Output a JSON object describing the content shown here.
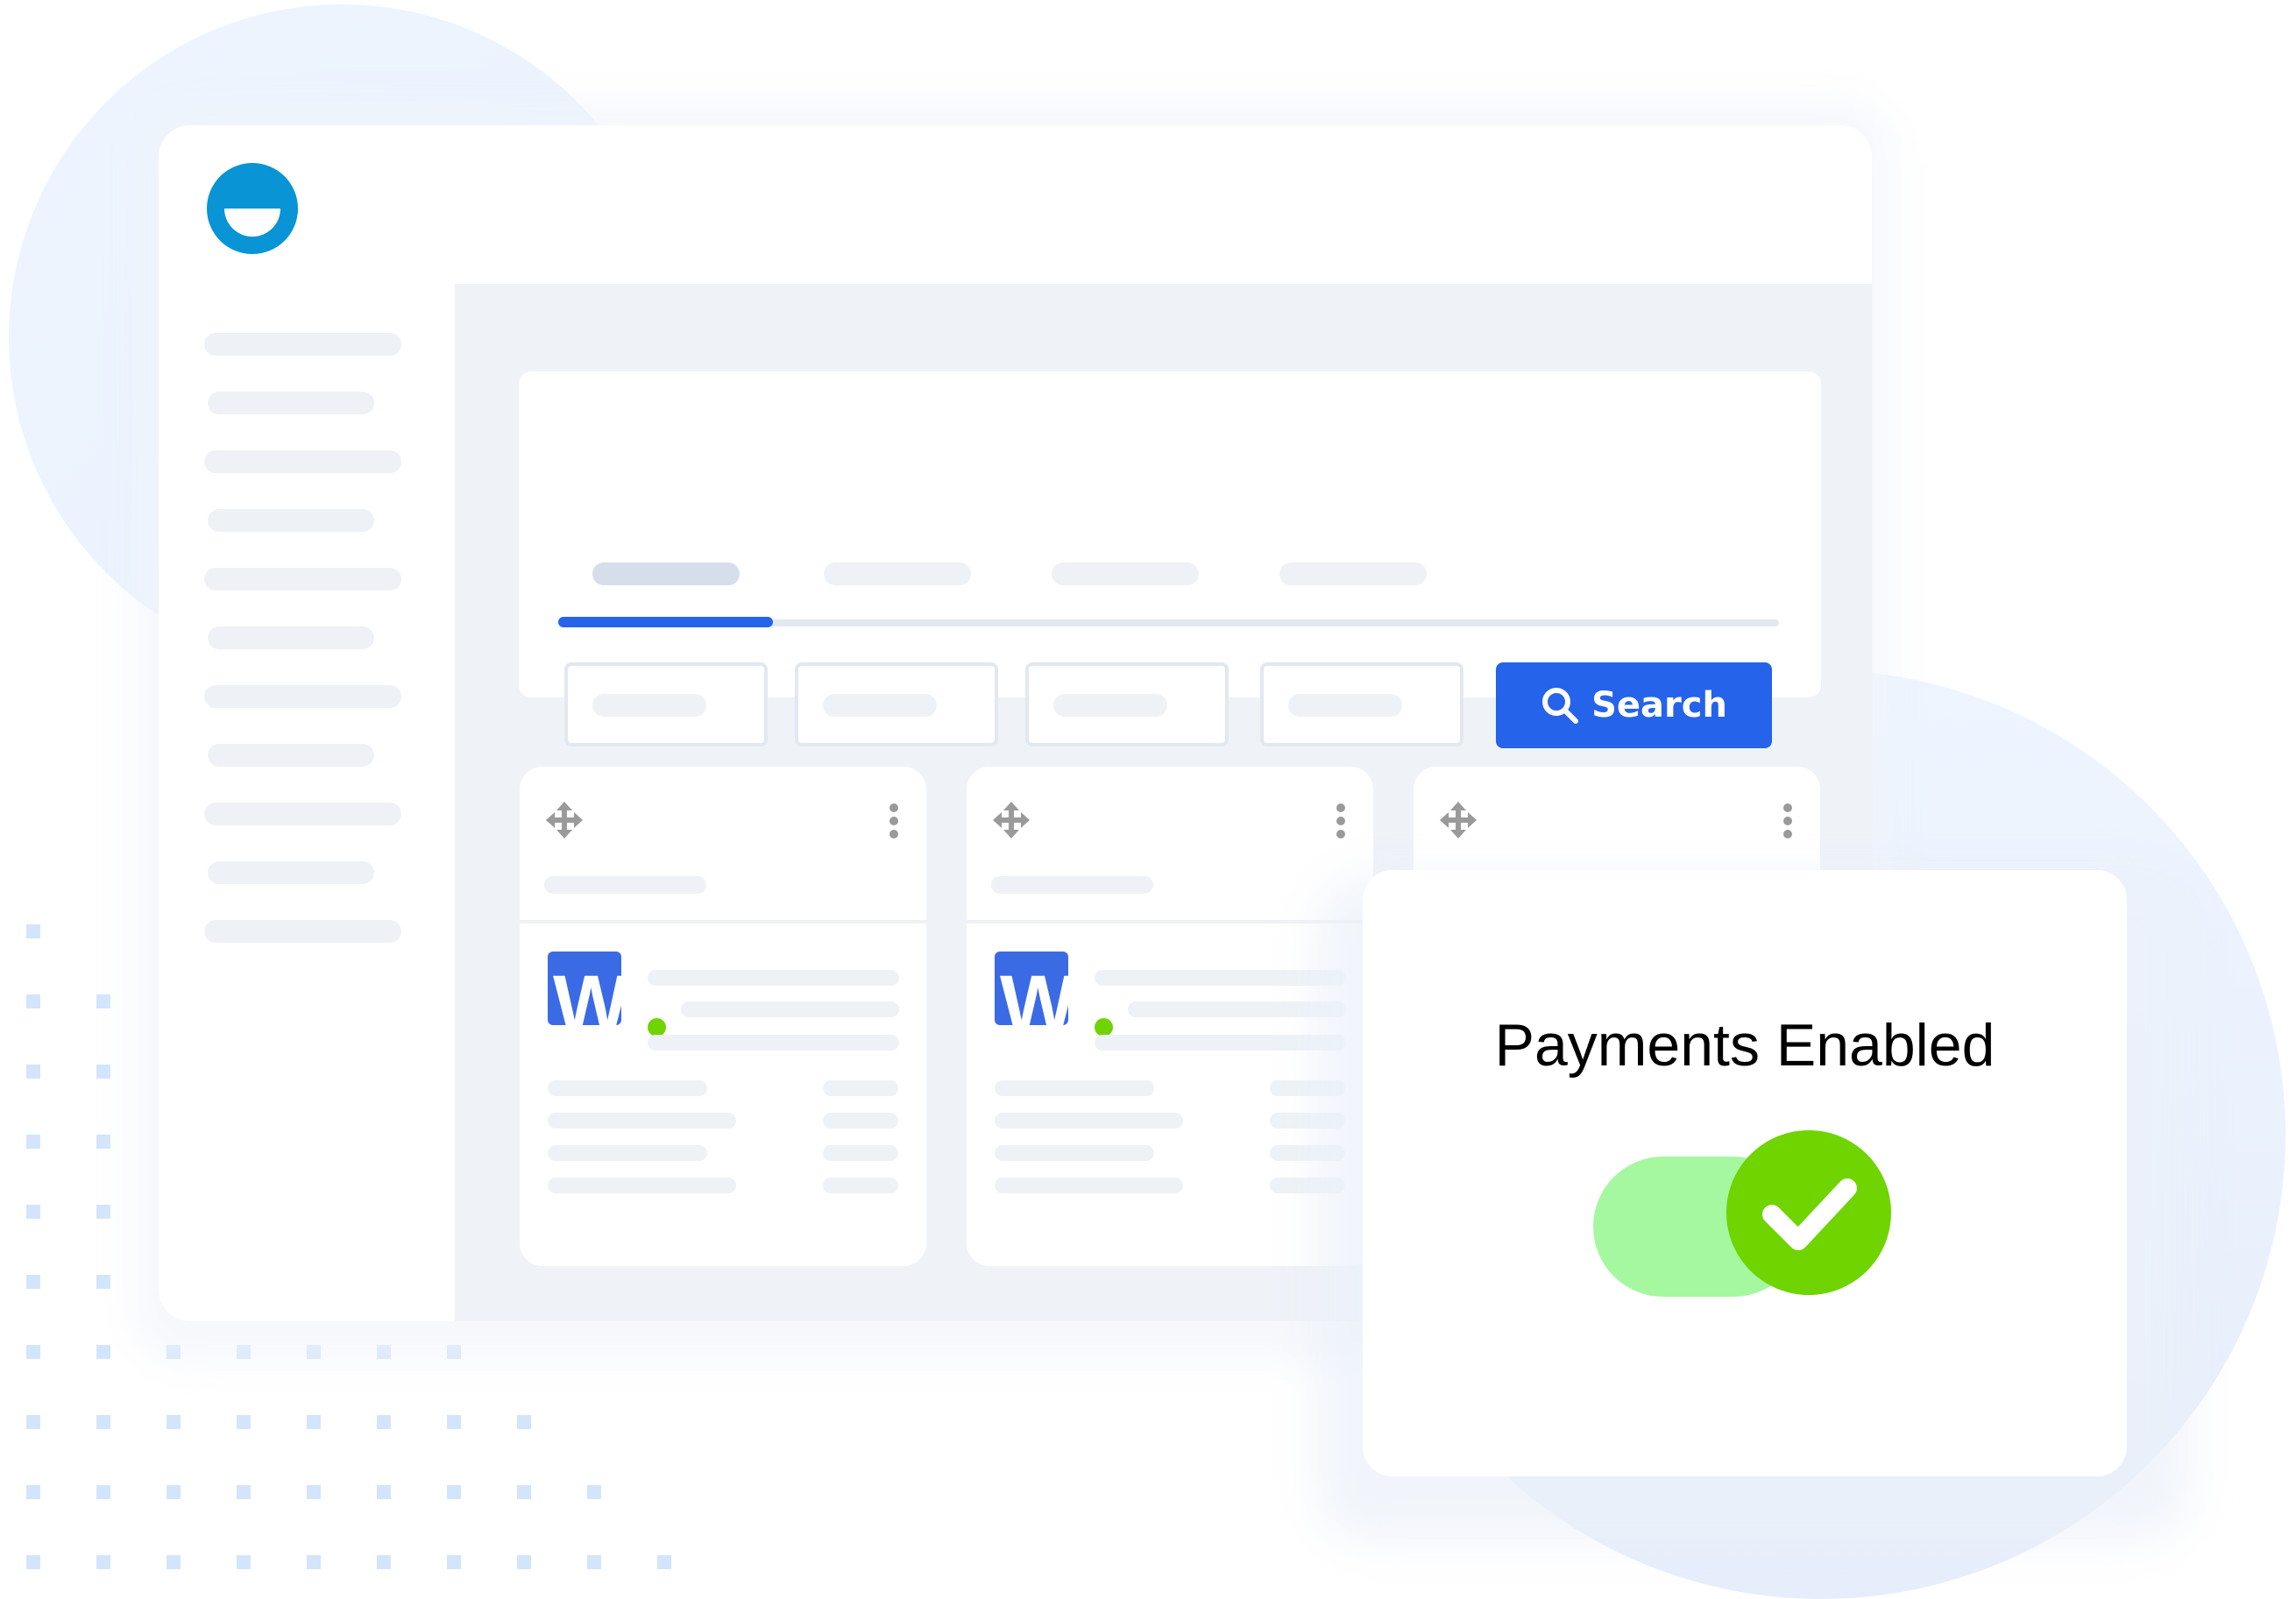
{
  "app": {
    "logo_icon": "smile-logo-icon"
  },
  "sidebar": {
    "items": [
      {
        "placeholder": "skeleton-line"
      },
      {
        "placeholder": "skeleton-line"
      },
      {
        "placeholder": "skeleton-line"
      },
      {
        "placeholder": "skeleton-line"
      },
      {
        "placeholder": "skeleton-line"
      },
      {
        "placeholder": "skeleton-line"
      },
      {
        "placeholder": "skeleton-line"
      },
      {
        "placeholder": "skeleton-line"
      },
      {
        "placeholder": "skeleton-line"
      },
      {
        "placeholder": "skeleton-line"
      },
      {
        "placeholder": "skeleton-line"
      }
    ]
  },
  "search_panel": {
    "tabs": [
      {
        "active": true
      },
      {
        "active": false
      },
      {
        "active": false
      },
      {
        "active": false
      }
    ],
    "filters": [
      {
        "placeholder": ""
      },
      {
        "placeholder": ""
      },
      {
        "placeholder": ""
      },
      {
        "placeholder": ""
      }
    ],
    "search_button": {
      "label": "Search",
      "icon": "search-icon",
      "color": "#2563eb"
    }
  },
  "cards": [
    {
      "logo_letter": "W",
      "status": "online",
      "status_color": "#6fd400",
      "drag_icon": "move-icon",
      "menu_icon": "kebab-icon"
    },
    {
      "logo_letter": "W",
      "status": "online",
      "status_color": "#6fd400",
      "drag_icon": "move-icon",
      "menu_icon": "kebab-icon"
    },
    {
      "drag_icon": "move-icon",
      "menu_icon": "kebab-icon"
    }
  ],
  "modal": {
    "title": "Payments Enabled",
    "toggle": {
      "state": "on",
      "icon": "checkmark-icon",
      "track_color": "#a5f89f",
      "knob_color": "#6fd400"
    }
  },
  "colors": {
    "brand_logo": "#0894d5",
    "accent": "#2563eb",
    "word_logo": "#3b6ae5"
  }
}
